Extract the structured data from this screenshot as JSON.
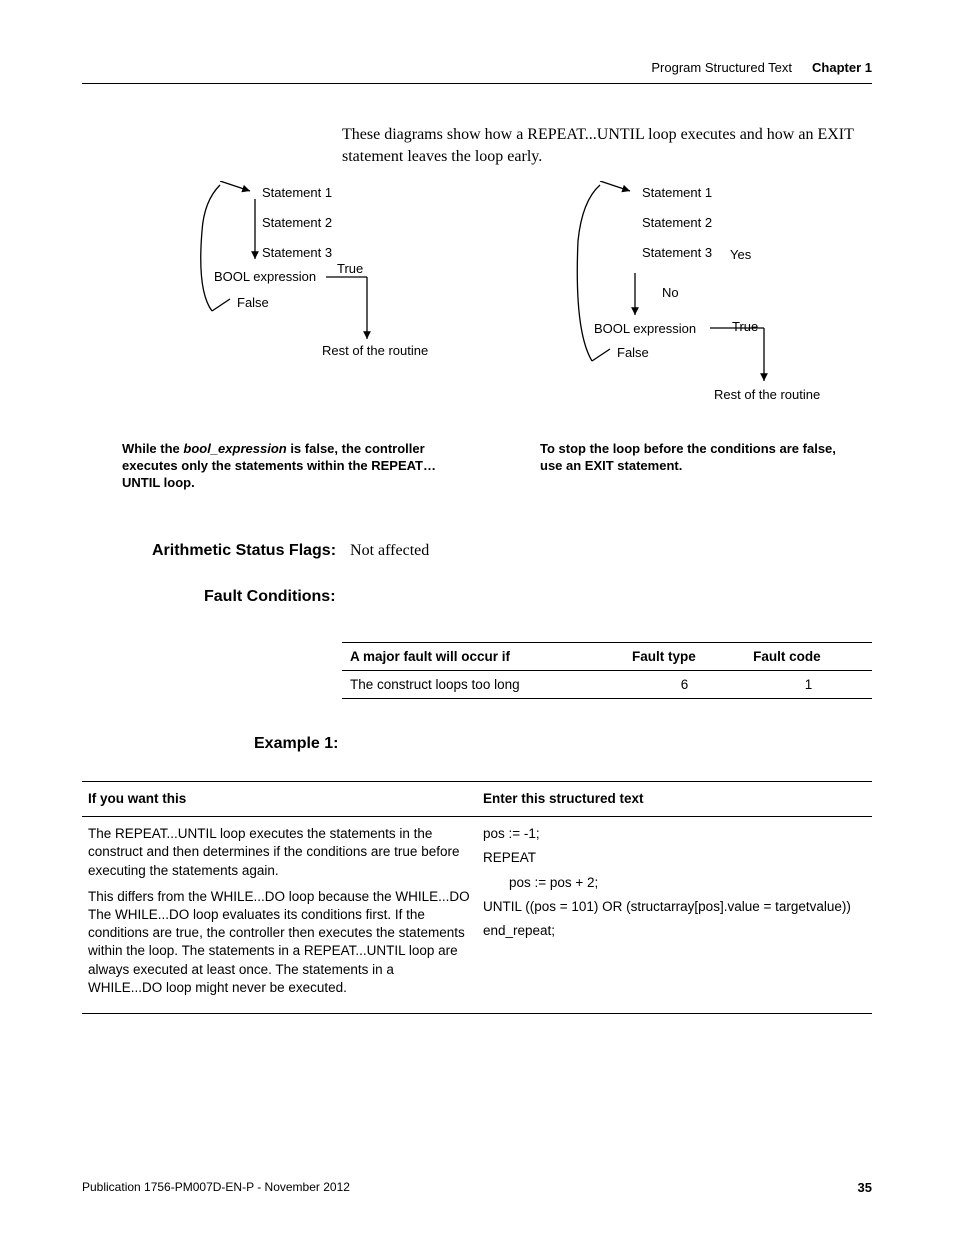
{
  "header": {
    "section": "Program Structured Text",
    "chapter": "Chapter 1"
  },
  "intro": "These diagrams show how a REPEAT...UNTIL loop executes and how an EXIT statement leaves the loop early.",
  "diagram_left": {
    "l1": "Statement 1",
    "l2": "Statement 2",
    "l3": "Statement 3",
    "be": "BOOL expression",
    "tr": "True",
    "fa": "False",
    "rest": "Rest of the routine"
  },
  "diagram_right": {
    "l1": "Statement 1",
    "l2": "Statement 2",
    "l3": "Statement 3",
    "yes": "Yes",
    "no": "No",
    "be": "BOOL expression",
    "tr": "True",
    "fa": "False",
    "rest": "Rest of the routine"
  },
  "caption_left_pre": "While the ",
  "caption_left_em": "bool_expression",
  "caption_left_post": " is false, the controller executes only the statements within the REPEAT…UNTIL loop.",
  "caption_right": "To stop the loop before the conditions are false, use an EXIT statement.",
  "arith": {
    "label": "Arithmetic Status Flags:",
    "value": "Not affected"
  },
  "fault_heading": "Fault Conditions:",
  "fault_table": {
    "headers": [
      "A major fault will occur if",
      "Fault type",
      "Fault code"
    ],
    "row": [
      "The construct loops too long",
      "6",
      "1"
    ]
  },
  "example_heading": "Example 1:",
  "example_table": {
    "headers": [
      "If you want this",
      "Enter this structured text"
    ],
    "left_p1": "The REPEAT...UNTIL loop executes the statements in the construct and then determines if the conditions are true before executing the statements again.",
    "left_p2": "This differs from the WHILE...DO loop because the WHILE...DO The WHILE...DO loop evaluates its conditions first. If the conditions are true, the controller then executes the statements within the loop. The statements in a REPEAT...UNTIL loop are always executed at least once. The statements in a WHILE...DO loop might never be executed.",
    "code": {
      "l1": "pos := -1;",
      "l2": "REPEAT",
      "l3": "pos := pos + 2;",
      "l4": "UNTIL ((pos = 101) OR (structarray[pos].value = targetvalue))",
      "l5": "end_repeat;"
    }
  },
  "footer": {
    "pub": "Publication 1756-PM007D-EN-P - November 2012",
    "page": "35"
  }
}
